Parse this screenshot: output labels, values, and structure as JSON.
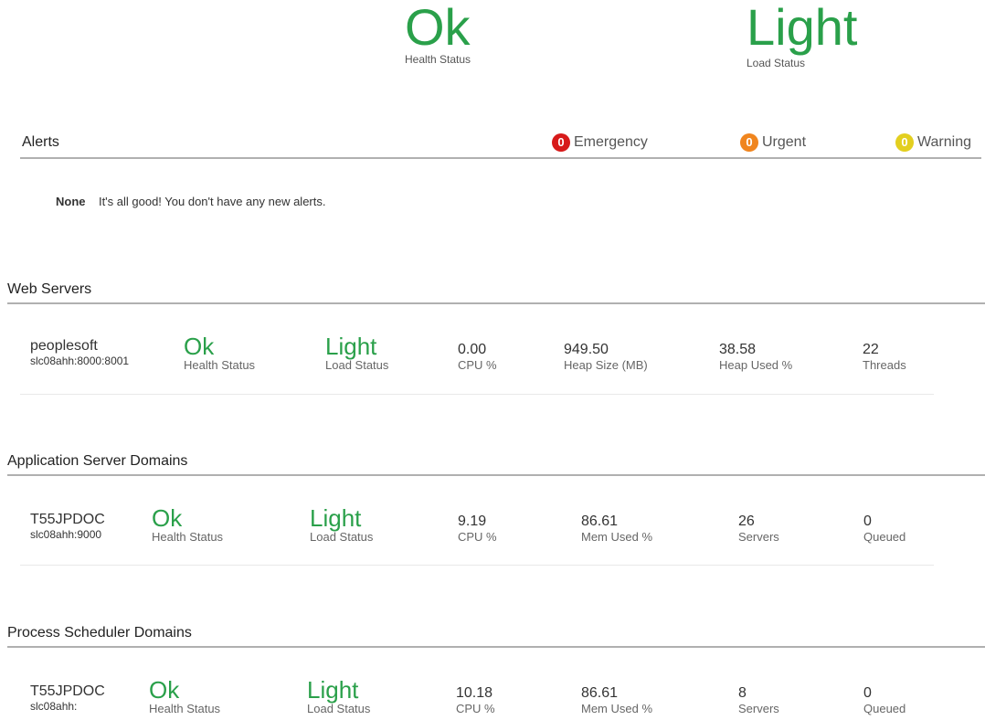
{
  "summary": {
    "health_value": "Ok",
    "health_label": "Health Status",
    "load_value": "Light",
    "load_label": "Load Status"
  },
  "alerts": {
    "title": "Alerts",
    "emergency": {
      "count": "0",
      "label": "Emergency",
      "color": "#d71a1a"
    },
    "urgent": {
      "count": "0",
      "label": "Urgent",
      "color": "#f0851e"
    },
    "warning": {
      "count": "0",
      "label": "Warning",
      "color": "#e3cf1f"
    },
    "none_label": "None",
    "none_message": "It's all good! You don't have any new alerts."
  },
  "web_servers": {
    "title": "Web Servers",
    "row": {
      "name": "peoplesoft",
      "address": "slc08ahh:8000:8001",
      "health": "Ok",
      "health_label": "Health Status",
      "load": "Light",
      "load_label": "Load Status",
      "metrics": [
        {
          "value": "0.00",
          "label": "CPU %"
        },
        {
          "value": "949.50",
          "label": "Heap Size (MB)"
        },
        {
          "value": "38.58",
          "label": "Heap Used %"
        },
        {
          "value": "22",
          "label": "Threads"
        }
      ]
    }
  },
  "app_servers": {
    "title": "Application Server Domains",
    "row": {
      "name": "T55JPDOC",
      "address": "slc08ahh:9000",
      "health": "Ok",
      "health_label": "Health Status",
      "load": "Light",
      "load_label": "Load Status",
      "metrics": [
        {
          "value": "9.19",
          "label": "CPU %"
        },
        {
          "value": "86.61",
          "label": "Mem Used %"
        },
        {
          "value": "26",
          "label": "Servers"
        },
        {
          "value": "0",
          "label": "Queued"
        }
      ]
    }
  },
  "process_scheduler": {
    "title": "Process Scheduler Domains",
    "row": {
      "name": "T55JPDOC",
      "address": "slc08ahh:",
      "health": "Ok",
      "health_label": "Health Status",
      "load": "Light",
      "load_label": "Load Status",
      "metrics": [
        {
          "value": "10.18",
          "label": "CPU %"
        },
        {
          "value": "86.61",
          "label": "Mem Used %"
        },
        {
          "value": "8",
          "label": "Servers"
        },
        {
          "value": "0",
          "label": "Queued"
        }
      ]
    }
  },
  "colors": {
    "status_green": "#2aa04a"
  }
}
